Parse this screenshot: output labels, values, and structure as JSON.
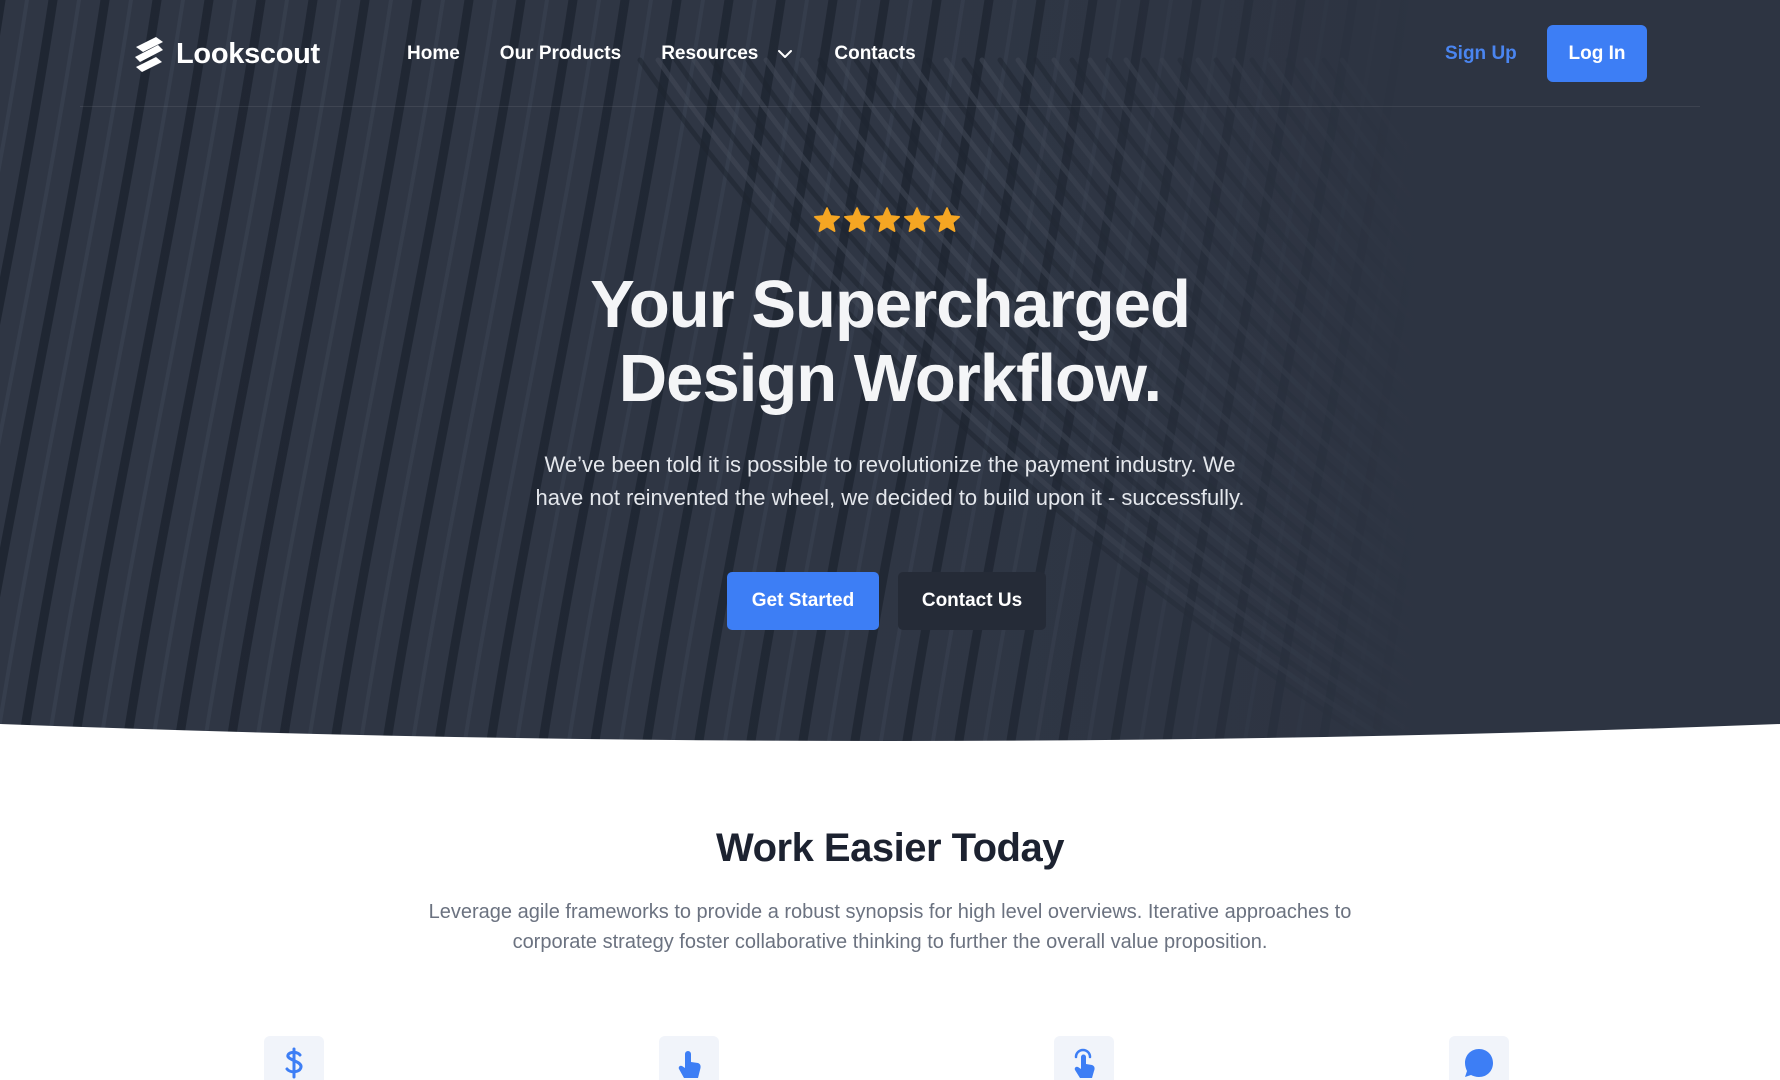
{
  "brand": {
    "name": "Lookscout",
    "logo_icon": "stacked-stripes-logo-icon"
  },
  "nav": {
    "items": [
      {
        "label": "Home"
      },
      {
        "label": "Our Products"
      },
      {
        "label": "Resources",
        "icon": "chevron-down-icon"
      },
      {
        "label": "Contacts"
      }
    ],
    "signup_label": "Sign Up",
    "login_label": "Log In"
  },
  "hero": {
    "rating": 5,
    "rating_max": 5,
    "title_line1": "Your Supercharged",
    "title_line2": "Design Workflow.",
    "subtitle_line1": "We’ve been told it is possible to revolutionize the payment industry. We",
    "subtitle_line2": "have not reinvented the wheel, we decided to build upon it - successfully.",
    "primary_cta": "Get Started",
    "secondary_cta": "Contact Us"
  },
  "section": {
    "title": "Work Easier Today",
    "text_line1": "Leverage agile frameworks to provide a robust synopsis for high level overviews. Iterative approaches to",
    "text_line2": "corporate strategy foster collaborative thinking to further the overall value proposition.",
    "features": [
      {
        "icon": "dollar-icon"
      },
      {
        "icon": "pointer-hand-icon"
      },
      {
        "icon": "tap-hand-icon"
      },
      {
        "icon": "chat-bubble-icon"
      }
    ]
  },
  "colors": {
    "accent": "#3d7ef5",
    "hero_bg": "#2d3442",
    "star": "#f5a623",
    "heading_dark": "#1c2230"
  }
}
